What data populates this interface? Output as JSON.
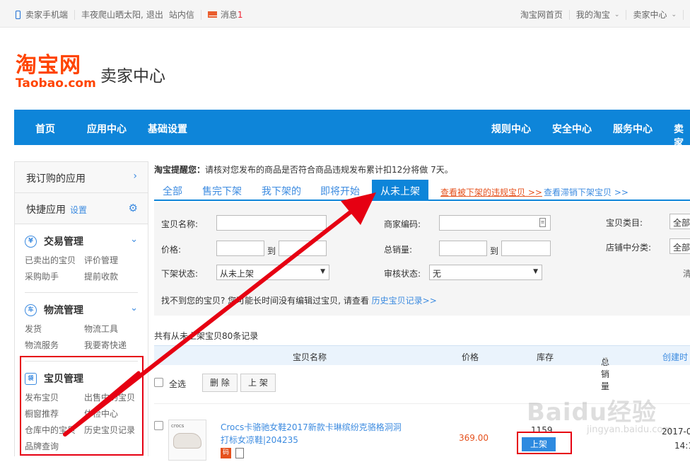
{
  "topbar": {
    "seller_mobile": "卖家手机端",
    "user": "丰夜爬山晒太阳,",
    "logout": "退出",
    "site_msg": "站内信",
    "msg_label": "消息",
    "msg_count": "1",
    "taobao_home": "淘宝网首页",
    "my_taobao": "我的淘宝",
    "seller_center": "卖家中心"
  },
  "logo": {
    "main": "淘宝网",
    "sub": "Taobao.com",
    "title": "卖家中心"
  },
  "nav": {
    "left": [
      "首页",
      "应用中心",
      "基础设置"
    ],
    "right": [
      "规则中心",
      "安全中心",
      "服务中心",
      "卖家"
    ]
  },
  "sidebar": {
    "subscribed": "我订购的应用",
    "quick": "快捷应用",
    "quick_set": "设置",
    "groups": [
      {
        "title": "交易管理",
        "icon": "¥",
        "links": [
          "已卖出的宝贝",
          "评价管理",
          "采购助手",
          "提前收款"
        ]
      },
      {
        "title": "物流管理",
        "icon": "车",
        "links": [
          "发货",
          "物流工具",
          "物流服务",
          "我要寄快递"
        ]
      },
      {
        "title": "宝贝管理",
        "icon": "袋",
        "links": [
          "发布宝贝",
          "出售中的宝贝",
          "橱窗推荐",
          "体检中心",
          "仓库中的宝贝",
          "历史宝贝记录",
          "品牌查询"
        ]
      }
    ]
  },
  "main": {
    "remind_label": "淘宝提醒您：",
    "remind_text": "请核对您发布的商品是否符合商品违规发布累计扣12分将做 7天。",
    "tabs": [
      "全部",
      "售完下架",
      "我下架的",
      "即将开始",
      "从未上架"
    ],
    "tab_link_1": "查看被下架的违规宝贝 >>",
    "tab_link_2": "查看滞销下架宝贝 >>",
    "filter": {
      "name_label": "宝贝名称:",
      "code_label": "商家编码:",
      "category_label": "宝贝类目:",
      "category_value": "全部",
      "price_label": "价格:",
      "to1": "到",
      "sales_label": "总销量:",
      "to2": "到",
      "shop_cat_label": "店铺中分类:",
      "shop_cat_value": "全部",
      "off_status_label": "下架状态:",
      "off_status_value": "从未上架",
      "audit_label": "审核状态:",
      "audit_value": "无",
      "clear": "清",
      "hist_text": "找不到您的宝贝? 您可能长时间没有编辑过宝贝, 请查看",
      "hist_link": "历史宝贝记录>>"
    },
    "count_text": "共有从未上架宝贝80条记录",
    "table_headers": [
      "宝贝名称",
      "价格",
      "库存",
      "总销量",
      "创建时"
    ],
    "select_all": "全选",
    "btn_delete": "删 除",
    "btn_up": "上 架",
    "product": {
      "brand": "crocs",
      "title": "Crocs卡骆驰女鞋2017新款卡琳缤纷克骆格洞洞打标女凉鞋|204235",
      "price": "369.00",
      "stock": "1159",
      "up_btn": "上架",
      "date": "2017-0",
      "time": "14:1",
      "badge": "码"
    }
  },
  "watermark": {
    "main": "Baidu经验",
    "sub": "jingyan.baidu.com"
  }
}
